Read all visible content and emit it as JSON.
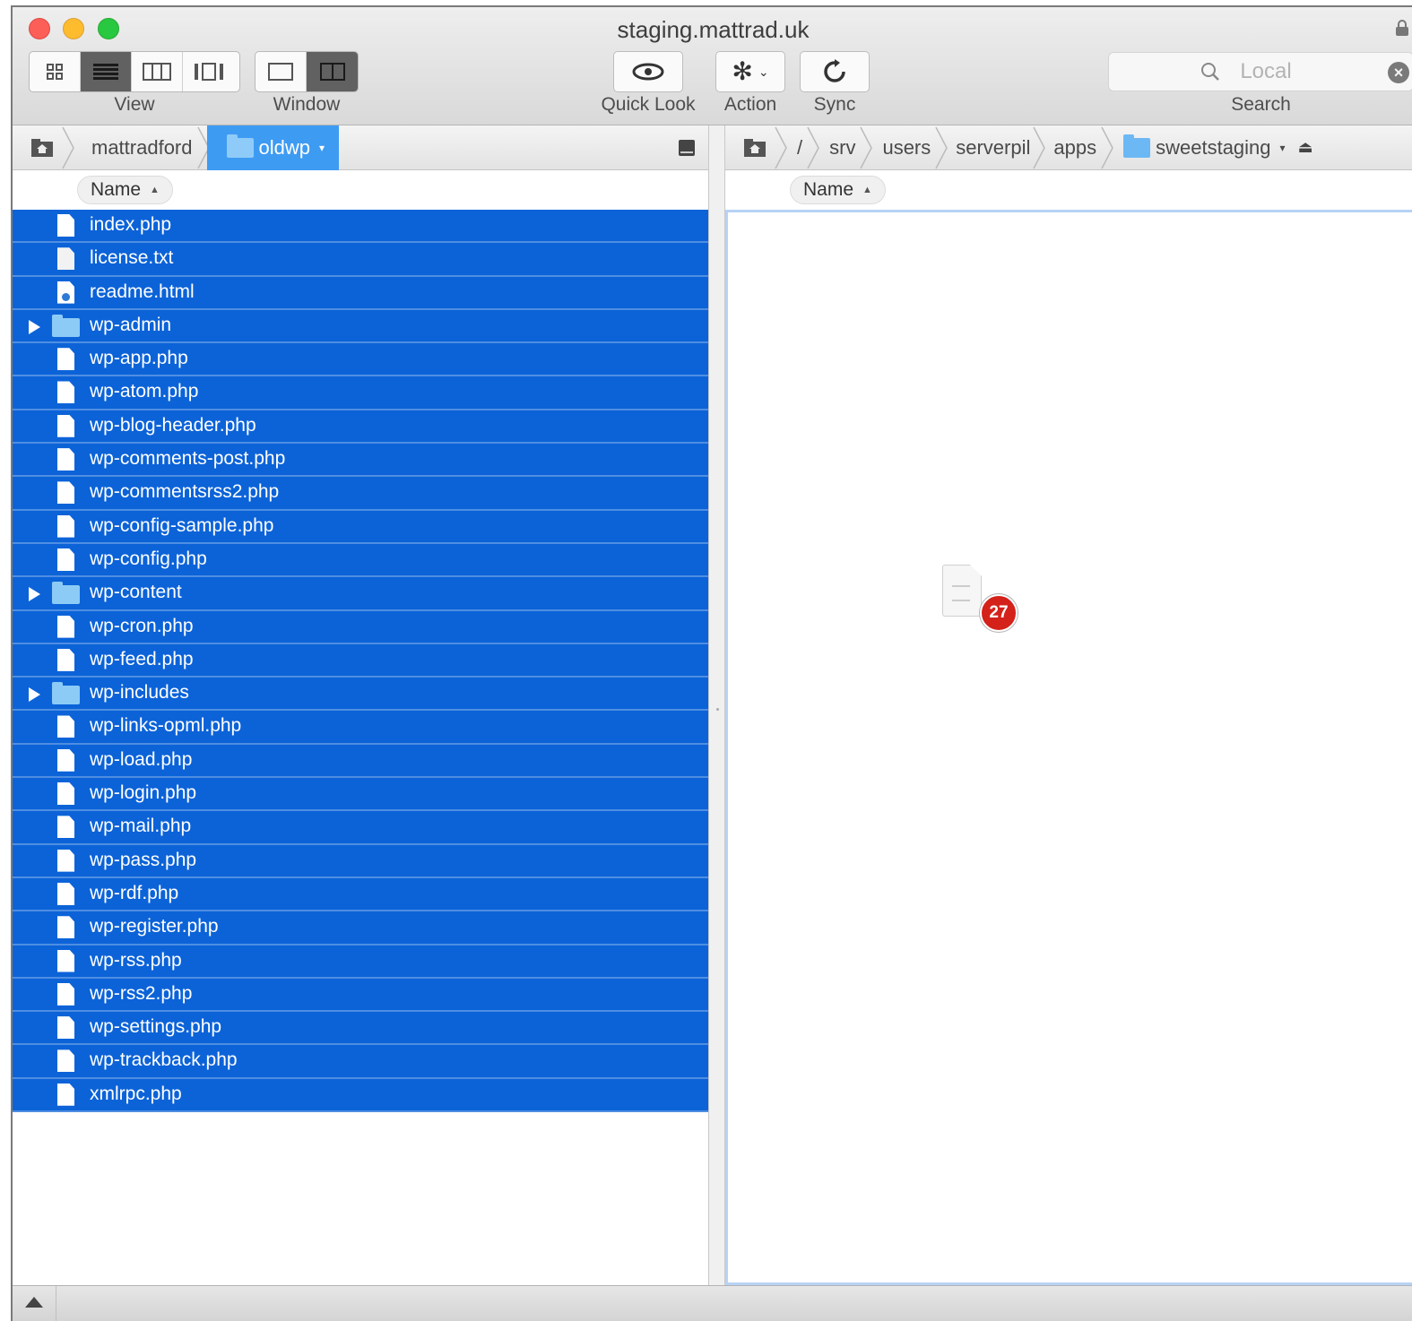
{
  "window": {
    "title": "staging.mattrad.uk"
  },
  "toolbar": {
    "view_label": "View",
    "window_label": "Window",
    "quicklook_label": "Quick Look",
    "action_label": "Action",
    "sync_label": "Sync",
    "search_label": "Search",
    "search_placeholder": "Local"
  },
  "left_pane": {
    "breadcrumb": [
      {
        "label": "mattradford"
      },
      {
        "label": "oldwp",
        "active": true
      }
    ],
    "column_header": "Name",
    "files": [
      {
        "name": "index.php",
        "type": "file"
      },
      {
        "name": "license.txt",
        "type": "text"
      },
      {
        "name": "readme.html",
        "type": "html"
      },
      {
        "name": "wp-admin",
        "type": "folder"
      },
      {
        "name": "wp-app.php",
        "type": "file"
      },
      {
        "name": "wp-atom.php",
        "type": "file"
      },
      {
        "name": "wp-blog-header.php",
        "type": "file"
      },
      {
        "name": "wp-comments-post.php",
        "type": "file"
      },
      {
        "name": "wp-commentsrss2.php",
        "type": "file"
      },
      {
        "name": "wp-config-sample.php",
        "type": "file"
      },
      {
        "name": "wp-config.php",
        "type": "file"
      },
      {
        "name": "wp-content",
        "type": "folder"
      },
      {
        "name": "wp-cron.php",
        "type": "file"
      },
      {
        "name": "wp-feed.php",
        "type": "file"
      },
      {
        "name": "wp-includes",
        "type": "folder"
      },
      {
        "name": "wp-links-opml.php",
        "type": "file"
      },
      {
        "name": "wp-load.php",
        "type": "file"
      },
      {
        "name": "wp-login.php",
        "type": "file"
      },
      {
        "name": "wp-mail.php",
        "type": "file"
      },
      {
        "name": "wp-pass.php",
        "type": "file"
      },
      {
        "name": "wp-rdf.php",
        "type": "file"
      },
      {
        "name": "wp-register.php",
        "type": "file"
      },
      {
        "name": "wp-rss.php",
        "type": "file"
      },
      {
        "name": "wp-rss2.php",
        "type": "file"
      },
      {
        "name": "wp-settings.php",
        "type": "file"
      },
      {
        "name": "wp-trackback.php",
        "type": "file"
      },
      {
        "name": "xmlrpc.php",
        "type": "file"
      }
    ]
  },
  "right_pane": {
    "breadcrumb": [
      {
        "label": "/"
      },
      {
        "label": "srv"
      },
      {
        "label": "users"
      },
      {
        "label": "serverpil"
      },
      {
        "label": "apps"
      },
      {
        "label": "sweetstaging"
      }
    ],
    "column_header": "Name",
    "drag_badge_count": "27"
  },
  "colors": {
    "selection": "#0c63d8",
    "active_crumb": "#3e9bf2",
    "badge": "#d4211a"
  }
}
